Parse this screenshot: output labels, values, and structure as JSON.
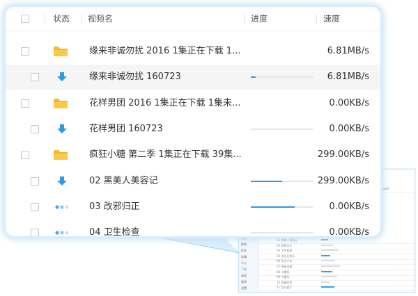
{
  "columns": {
    "status": "状态",
    "name": "视频名",
    "progress": "进度",
    "speed": "速度"
  },
  "rows": [
    {
      "type": "folder",
      "name": "缘来非诚勿扰 2016   1集正在下载 1...",
      "speed": "6.81MB/s",
      "progress": null
    },
    {
      "type": "download",
      "name": "缘来非诚勿扰 160723",
      "speed": "6.81MB/s",
      "progress": 0.08
    },
    {
      "type": "folder",
      "name": "花样男团 2016   1集正在下载 1集未...",
      "speed": "0.00KB/s",
      "progress": null
    },
    {
      "type": "download",
      "name": "花样男团 160723",
      "speed": "0.00KB/s",
      "progress": 0.0
    },
    {
      "type": "folder",
      "name": "疯狂小糖 第二季    1集正在下载 39集...",
      "speed": "299.00KB/s",
      "progress": null
    },
    {
      "type": "download",
      "name": "02 黑美人美容记",
      "speed": "299.00KB/s",
      "progress": 0.5
    },
    {
      "type": "waiting",
      "name": "03 改邪归正",
      "speed": "0.00KB/s",
      "progress": 0.7
    },
    {
      "type": "waiting",
      "name": "04 卫生检查",
      "speed": "0.00KB/s",
      "progress": 0.0
    }
  ],
  "background_window": {
    "header_text": "uanjoxh",
    "sidebar": [
      "最近",
      "影视",
      "综艺",
      "动漫",
      "少儿",
      "下载",
      "云盘",
      "离线",
      "设置"
    ],
    "rows": [
      {
        "name": "02 黑美人美容记"
      },
      {
        "name": "03 改邪归正"
      },
      {
        "name": "04 卫生检查"
      },
      {
        "name": "05 毕业日快乐"
      },
      {
        "name": "06 天才少年"
      },
      {
        "name": "07 神秘访客"
      },
      {
        "name": "08 小魔怪"
      },
      {
        "name": "09 大冒险"
      },
      {
        "name": "10 穿越时空"
      },
      {
        "name": "11 音乐盒子"
      }
    ]
  },
  "colors": {
    "accent": "#2b9be6",
    "folder": "#f7b62c",
    "panel_glow": "#bfe0f7"
  }
}
